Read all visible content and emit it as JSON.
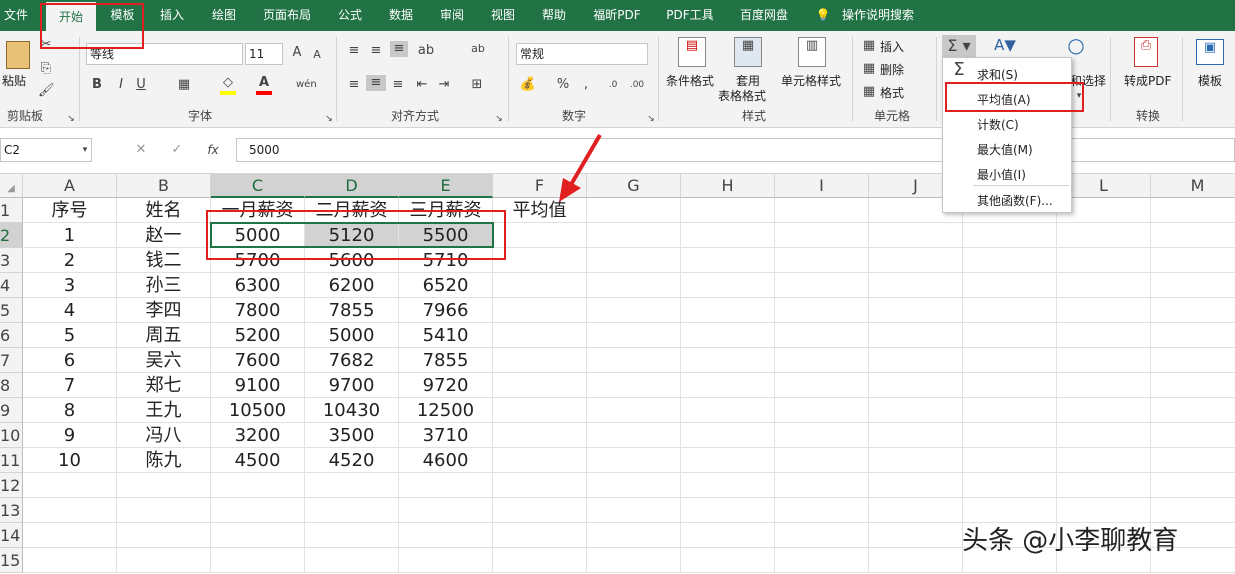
{
  "menu": [
    "文件",
    "开始",
    "模板",
    "插入",
    "绘图",
    "页面布局",
    "公式",
    "数据",
    "审阅",
    "视图",
    "帮助",
    "福昕PDF",
    "PDF工具",
    "百度网盘",
    "操作说明搜索"
  ],
  "ribbon": {
    "clipboard": {
      "paste": "粘贴",
      "label": "剪贴板"
    },
    "font": {
      "name": "等线",
      "size": "11",
      "bold": "B",
      "italic": "I",
      "underline": "U",
      "label": "字体"
    },
    "align": {
      "label": "对齐方式"
    },
    "number": {
      "format": "常规",
      "label": "数字",
      "percent": "%"
    },
    "styles": {
      "cond": "条件格式",
      "table1": "套用",
      "table2": "表格格式",
      "cell": "单元格样式",
      "label": "样式"
    },
    "cells": {
      "insert": "插入",
      "delete": "删除",
      "format": "格式",
      "label": "单元格"
    },
    "editing": {
      "find": "和选择"
    },
    "convert": {
      "pdf": "转成PDF",
      "label": "转换"
    },
    "template": {
      "label": "模板"
    }
  },
  "autosum_menu": [
    "求和(S)",
    "平均值(A)",
    "计数(C)",
    "最大值(M)",
    "最小值(I)",
    "其他函数(F)..."
  ],
  "formula_bar": {
    "cell_ref": "C2",
    "value": "5000",
    "fx": "fx"
  },
  "columns": [
    "A",
    "B",
    "C",
    "D",
    "E",
    "F",
    "G",
    "H",
    "I",
    "J",
    "L",
    "M"
  ],
  "rows": [
    "1",
    "2",
    "3",
    "4",
    "5",
    "6",
    "7",
    "8",
    "9",
    "10",
    "11",
    "12",
    "13",
    "14",
    "15"
  ],
  "table": [
    [
      "序号",
      "姓名",
      "一月薪资",
      "二月薪资",
      "三月薪资",
      "平均值"
    ],
    [
      "1",
      "赵一",
      "5000",
      "5120",
      "5500",
      ""
    ],
    [
      "2",
      "钱二",
      "5700",
      "5600",
      "5710",
      ""
    ],
    [
      "3",
      "孙三",
      "6300",
      "6200",
      "6520",
      ""
    ],
    [
      "4",
      "李四",
      "7800",
      "7855",
      "7966",
      ""
    ],
    [
      "5",
      "周五",
      "5200",
      "5000",
      "5410",
      ""
    ],
    [
      "6",
      "吴六",
      "7600",
      "7682",
      "7855",
      ""
    ],
    [
      "7",
      "郑七",
      "9100",
      "9700",
      "9720",
      ""
    ],
    [
      "8",
      "王九",
      "10500",
      "10430",
      "12500",
      ""
    ],
    [
      "9",
      "冯八",
      "3200",
      "3500",
      "3710",
      ""
    ],
    [
      "10",
      "陈九",
      "4500",
      "4520",
      "4600",
      ""
    ]
  ],
  "watermark": "头条 @小李聊教育",
  "colors": {
    "accent": "#217346",
    "highlight": "#e02020"
  }
}
